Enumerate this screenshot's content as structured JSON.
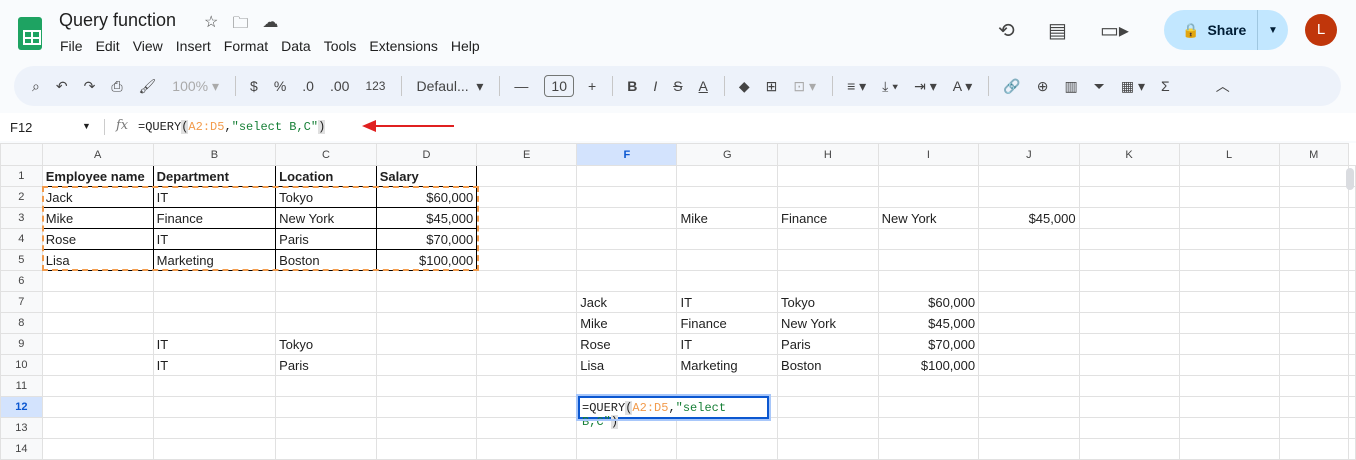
{
  "app": {
    "title": "Query function",
    "menu": [
      "File",
      "Edit",
      "View",
      "Insert",
      "Format",
      "Data",
      "Tools",
      "Extensions",
      "Help"
    ],
    "share_label": "Share",
    "avatar_letter": "L"
  },
  "toolbar": {
    "zoom": "100%",
    "dollar": "$",
    "percent": "%",
    "dec_decrease": ".0",
    "dec_increase": ".00",
    "number_format": "123",
    "font": "Defaul...",
    "font_size": "10"
  },
  "formula_bar": {
    "name_box": "F12",
    "fx": "fx",
    "prefix": "=QUERY",
    "open": "(",
    "ref": "A2:D5",
    "comma": ",",
    "str": "\"select B,C\"",
    "close": ")"
  },
  "columns": [
    "A",
    "B",
    "C",
    "D",
    "E",
    "F",
    "G",
    "H",
    "I",
    "J",
    "K",
    "L",
    "M"
  ],
  "rows": [
    [
      "Employee name",
      "Department",
      "Location",
      "Salary",
      "",
      "",
      "",
      "",
      "",
      "",
      "",
      "",
      ""
    ],
    [
      "Jack",
      "IT",
      "Tokyo",
      "$60,000",
      "",
      "",
      "",
      "",
      "",
      "",
      "",
      "",
      ""
    ],
    [
      "Mike",
      "Finance",
      "New York",
      "$45,000",
      "",
      "",
      "Mike",
      "Finance",
      "New York",
      "$45,000",
      "",
      "",
      ""
    ],
    [
      "Rose",
      "IT",
      "Paris",
      "$70,000",
      "",
      "",
      "",
      "",
      "",
      "",
      "",
      "",
      ""
    ],
    [
      "Lisa",
      "Marketing",
      "Boston",
      "$100,000",
      "",
      "",
      "",
      "",
      "",
      "",
      "",
      "",
      ""
    ],
    [
      "",
      "",
      "",
      "",
      "",
      "",
      "",
      "",
      "",
      "",
      "",
      "",
      ""
    ],
    [
      "",
      "",
      "",
      "",
      "",
      "Jack",
      "IT",
      "Tokyo",
      "$60,000",
      "",
      "",
      "",
      ""
    ],
    [
      "",
      "",
      "",
      "",
      "",
      "Mike",
      "Finance",
      "New York",
      "$45,000",
      "",
      "",
      "",
      ""
    ],
    [
      "",
      "IT",
      "Tokyo",
      "",
      "",
      "Rose",
      "IT",
      "Paris",
      "$70,000",
      "",
      "",
      "",
      ""
    ],
    [
      "",
      "IT",
      "Paris",
      "",
      "",
      "Lisa",
      "Marketing",
      "Boston",
      "$100,000",
      "",
      "",
      "",
      ""
    ],
    [
      "",
      "",
      "",
      "",
      "",
      "",
      "",
      "",
      "",
      "",
      "",
      "",
      ""
    ],
    [
      "",
      "",
      "",
      "",
      "",
      "",
      "",
      "",
      "",
      "",
      "",
      "",
      ""
    ],
    [
      "",
      "",
      "",
      "",
      "",
      "",
      "",
      "",
      "",
      "",
      "",
      "",
      ""
    ],
    [
      "",
      "",
      "",
      "",
      "",
      "",
      "",
      "",
      "",
      "",
      "",
      "",
      ""
    ]
  ],
  "selected": {
    "cell": "F12",
    "column": "F",
    "row": 12
  }
}
